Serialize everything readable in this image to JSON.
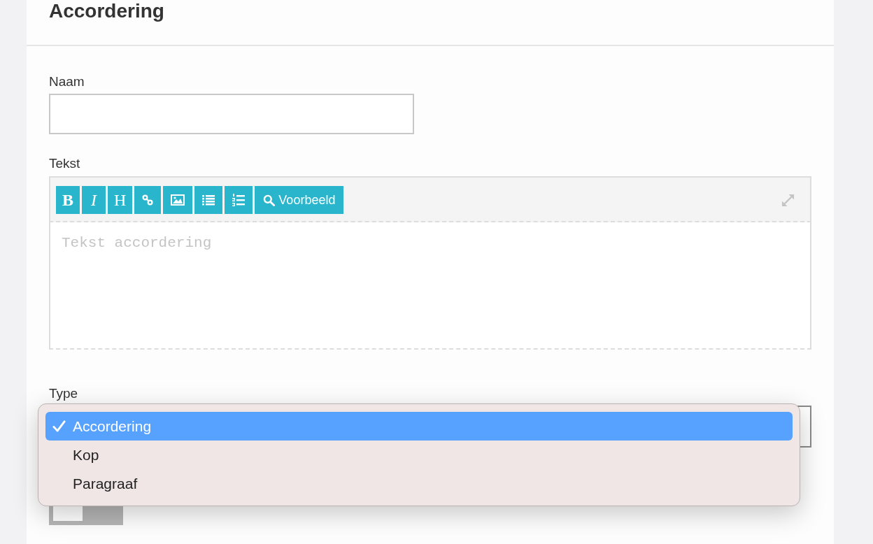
{
  "title": "Accordering",
  "name_field": {
    "label": "Naam"
  },
  "text_field": {
    "label": "Tekst",
    "toolbar": [
      {
        "kind": "bold",
        "label": "B"
      },
      {
        "kind": "italic",
        "label": "I"
      },
      {
        "kind": "heading",
        "label": "H"
      },
      {
        "kind": "link"
      },
      {
        "kind": "image"
      },
      {
        "kind": "bullets"
      },
      {
        "kind": "numbers"
      },
      {
        "kind": "preview",
        "label": "Voorbeeld"
      }
    ],
    "placeholder": "Tekst accordering"
  },
  "type_field": {
    "label": "Type",
    "dropdown": {
      "expanded": true,
      "options": [
        {
          "label": "Accordering",
          "selected": true
        },
        {
          "label": "Kop",
          "selected": false
        },
        {
          "label": "Paragraaf",
          "selected": false
        }
      ]
    }
  },
  "toggle": {
    "on": false
  }
}
